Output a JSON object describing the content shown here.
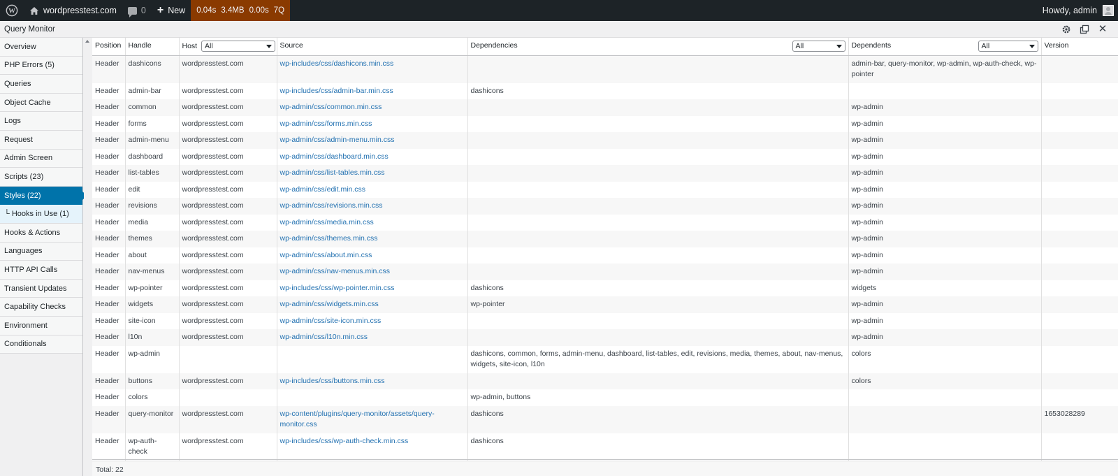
{
  "adminbar": {
    "site_name": "wordpresstest.com",
    "comments_count": "0",
    "new_label": "New",
    "qm_time": "0.04s",
    "qm_memory": "3.4MB",
    "qm_db_time": "0.00s",
    "qm_queries": "7Q",
    "howdy": "Howdy, admin",
    "qm_color": "#8a3a00"
  },
  "panel": {
    "title": "Query Monitor"
  },
  "sidebar": {
    "items": [
      {
        "label": "Overview"
      },
      {
        "label": "PHP Errors (5)"
      },
      {
        "label": "Queries"
      },
      {
        "label": "Object Cache"
      },
      {
        "label": "Logs"
      },
      {
        "label": "Request"
      },
      {
        "label": "Admin Screen"
      },
      {
        "label": "Scripts (23)"
      },
      {
        "label": "Styles (22)",
        "active": true
      },
      {
        "label": "└ Hooks in Use (1)",
        "sub": true
      },
      {
        "label": "Hooks & Actions"
      },
      {
        "label": "Languages"
      },
      {
        "label": "HTTP API Calls"
      },
      {
        "label": "Transient Updates"
      },
      {
        "label": "Capability Checks"
      },
      {
        "label": "Environment"
      },
      {
        "label": "Conditionals"
      }
    ]
  },
  "table": {
    "headers": {
      "position": "Position",
      "handle": "Handle",
      "host": "Host",
      "source": "Source",
      "dependencies": "Dependencies",
      "dependents": "Dependents",
      "version": "Version"
    },
    "filters": {
      "host": "All",
      "dependencies": "All",
      "dependents": "All"
    },
    "rows": [
      [
        "Header",
        "dashicons",
        "wordpresstest.com",
        "wp-includes/css/dashicons.min.css",
        "",
        "admin-bar, query-monitor, wp-admin, wp-auth-check, wp-pointer",
        ""
      ],
      [
        "Header",
        "admin-bar",
        "wordpresstest.com",
        "wp-includes/css/admin-bar.min.css",
        "dashicons",
        "",
        ""
      ],
      [
        "Header",
        "common",
        "wordpresstest.com",
        "wp-admin/css/common.min.css",
        "",
        "wp-admin",
        ""
      ],
      [
        "Header",
        "forms",
        "wordpresstest.com",
        "wp-admin/css/forms.min.css",
        "",
        "wp-admin",
        ""
      ],
      [
        "Header",
        "admin-menu",
        "wordpresstest.com",
        "wp-admin/css/admin-menu.min.css",
        "",
        "wp-admin",
        ""
      ],
      [
        "Header",
        "dashboard",
        "wordpresstest.com",
        "wp-admin/css/dashboard.min.css",
        "",
        "wp-admin",
        ""
      ],
      [
        "Header",
        "list-tables",
        "wordpresstest.com",
        "wp-admin/css/list-tables.min.css",
        "",
        "wp-admin",
        ""
      ],
      [
        "Header",
        "edit",
        "wordpresstest.com",
        "wp-admin/css/edit.min.css",
        "",
        "wp-admin",
        ""
      ],
      [
        "Header",
        "revisions",
        "wordpresstest.com",
        "wp-admin/css/revisions.min.css",
        "",
        "wp-admin",
        ""
      ],
      [
        "Header",
        "media",
        "wordpresstest.com",
        "wp-admin/css/media.min.css",
        "",
        "wp-admin",
        ""
      ],
      [
        "Header",
        "themes",
        "wordpresstest.com",
        "wp-admin/css/themes.min.css",
        "",
        "wp-admin",
        ""
      ],
      [
        "Header",
        "about",
        "wordpresstest.com",
        "wp-admin/css/about.min.css",
        "",
        "wp-admin",
        ""
      ],
      [
        "Header",
        "nav-menus",
        "wordpresstest.com",
        "wp-admin/css/nav-menus.min.css",
        "",
        "wp-admin",
        ""
      ],
      [
        "Header",
        "wp-pointer",
        "wordpresstest.com",
        "wp-includes/css/wp-pointer.min.css",
        "dashicons",
        "widgets",
        ""
      ],
      [
        "Header",
        "widgets",
        "wordpresstest.com",
        "wp-admin/css/widgets.min.css",
        "wp-pointer",
        "wp-admin",
        ""
      ],
      [
        "Header",
        "site-icon",
        "wordpresstest.com",
        "wp-admin/css/site-icon.min.css",
        "",
        "wp-admin",
        ""
      ],
      [
        "Header",
        "l10n",
        "wordpresstest.com",
        "wp-admin/css/l10n.min.css",
        "",
        "wp-admin",
        ""
      ],
      [
        "Header",
        "wp-admin",
        "",
        "",
        "dashicons, common, forms, admin-menu, dashboard, list-tables, edit, revisions, media, themes, about, nav-menus, widgets, site-icon, l10n",
        "colors",
        ""
      ],
      [
        "Header",
        "buttons",
        "wordpresstest.com",
        "wp-includes/css/buttons.min.css",
        "",
        "colors",
        ""
      ],
      [
        "Header",
        "colors",
        "",
        "",
        "wp-admin, buttons",
        "",
        ""
      ],
      [
        "Header",
        "query-monitor",
        "wordpresstest.com",
        "wp-content/plugins/query-monitor/assets/query-monitor.css",
        "dashicons",
        "",
        "1653028289"
      ],
      [
        "Header",
        "wp-auth-check",
        "wordpresstest.com",
        "wp-includes/css/wp-auth-check.min.css",
        "dashicons",
        "",
        ""
      ]
    ],
    "total": "Total: 22"
  }
}
